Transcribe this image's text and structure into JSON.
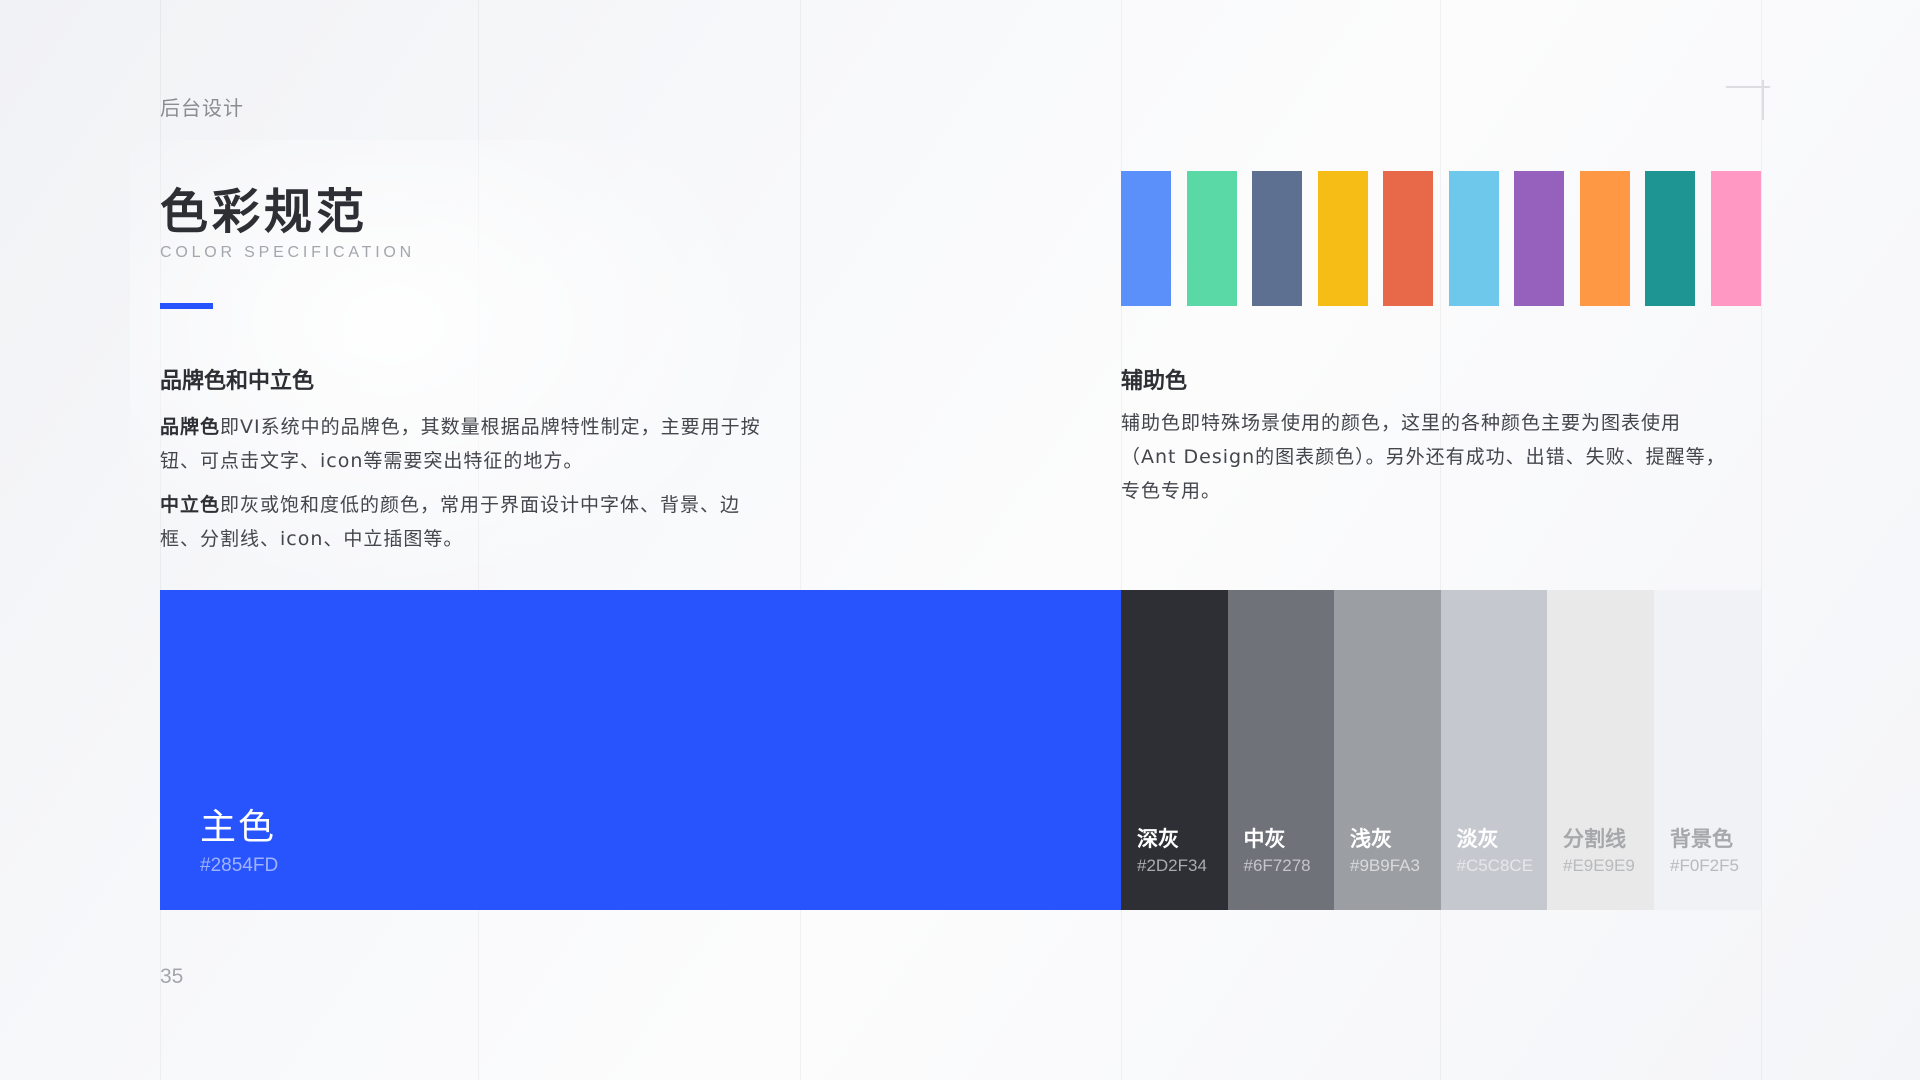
{
  "header": {
    "breadcrumb": "后台设计",
    "title": "色彩规范",
    "subtitle": "COLOR SPECIFICATION"
  },
  "brand_section": {
    "heading": "品牌色和中立色",
    "paragraphs": [
      {
        "bold": "品牌色",
        "line1": "即VI系统中的品牌色，其数量根据品牌特性制定，主要用于按",
        "line2": "钮、可点击文字、icon等需要突出特征的地方。"
      },
      {
        "bold": "中立色",
        "line1": "即灰或饱和度低的颜色，常用于界面设计中字体、背景、边",
        "line2": "框、分割线、icon、中立插图等。"
      }
    ]
  },
  "aux_section": {
    "heading": "辅助色",
    "lines": [
      "辅助色即特殊场景使用的颜色，这里的各种颜色主要为图表使用",
      "（Ant Design的图表颜色）。另外还有成功、出错、失败、提醒等，",
      "专色专用。"
    ]
  },
  "aux_swatches": [
    {
      "color": "#5B8FF9"
    },
    {
      "color": "#5AD8A6"
    },
    {
      "color": "#5D7092"
    },
    {
      "color": "#F6BD16"
    },
    {
      "color": "#E8684A"
    },
    {
      "color": "#6DC8EC"
    },
    {
      "color": "#9661BC"
    },
    {
      "color": "#FF9845"
    },
    {
      "color": "#1E9493"
    },
    {
      "color": "#FF99C3"
    }
  ],
  "primary": {
    "name": "主色",
    "hex": "#2854FD",
    "color": "#2854FD"
  },
  "neutrals": [
    {
      "name": "深灰",
      "hex": "#2D2F34",
      "color": "#2D2F34",
      "name_color": "#ffffff",
      "hex_color": "#a9abb0"
    },
    {
      "name": "中灰",
      "hex": "#6F7278",
      "color": "#6F7278",
      "name_color": "#ffffff",
      "hex_color": "#c4c6ca"
    },
    {
      "name": "浅灰",
      "hex": "#9B9FA3",
      "color": "#9B9FA3",
      "name_color": "#ffffff",
      "hex_color": "#d8dadc"
    },
    {
      "name": "淡灰",
      "hex": "#C5C8CE",
      "color": "#C5C8CE",
      "name_color": "#ffffff",
      "hex_color": "#e6e7ea"
    },
    {
      "name": "分割线",
      "hex": "#E9E9E9",
      "color": "#E9E9E9",
      "name_color": "#a6a8ac",
      "hex_color": "#b8babd"
    },
    {
      "name": "背景色",
      "hex": "#F0F2F5",
      "color": "#F0F2F5",
      "name_color": "#a6a8ac",
      "hex_color": "#b8babd"
    }
  ],
  "footer": {
    "page_number": "35"
  }
}
